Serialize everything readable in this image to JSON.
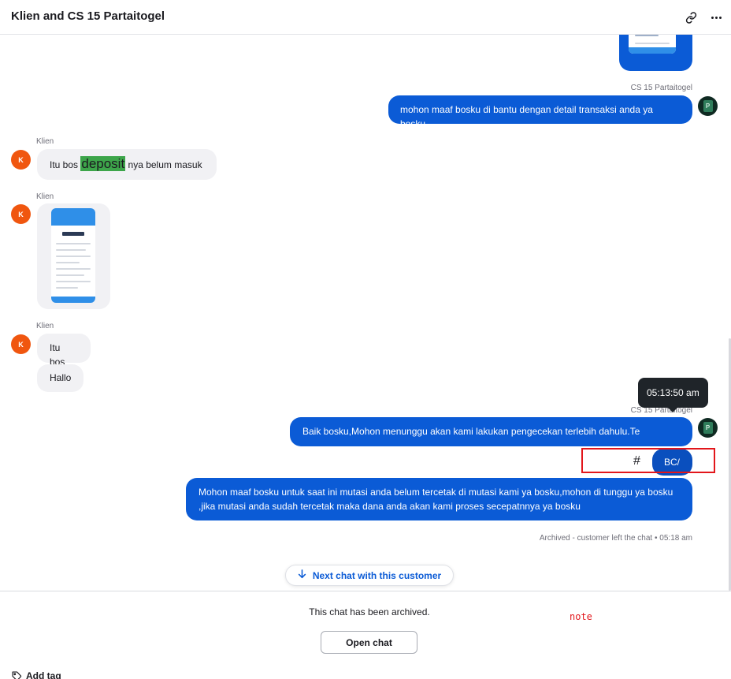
{
  "header": {
    "title": "Klien and CS 15 Partaitogel"
  },
  "agent": {
    "name": "CS 15 Partaitogel",
    "avatar_letter": "P"
  },
  "customer": {
    "name": "Klien",
    "avatar_letter": "K"
  },
  "messages": {
    "agent_1": "mohon maaf bosku di bantu dengan detail transaksi anda ya bosku",
    "customer_1_pre": "Itu bos ",
    "customer_1_highlight": "deposit",
    "customer_1_post": " nya belum masuk",
    "customer_3": "Itu bos",
    "customer_4": "Hallo",
    "agent_2": "Baik bosku,Mohon menunggu akan kami lakukan pengecekan terlebih dahulu.Te",
    "agent_3": "BC/",
    "agent_4_line1": "Mohon maaf bosku untuk saat ini mutasi anda belum tercetak di mutasi kami ya bosku,mohon di tunggu ya bosku",
    "agent_4_line2": ",jika mutasi anda sudah tercetak maka dana anda akan kami proses secepatnnya ya bosku"
  },
  "tooltip": {
    "time": "05:13:50 am"
  },
  "annotation": {
    "hash": "#",
    "note": "note",
    "color": "#e2161b"
  },
  "status": {
    "archived": "Archived - customer left the chat",
    "separator": "•",
    "time": "05:18 am"
  },
  "actions": {
    "next_chat": "Next chat with this customer",
    "archived_notice": "This chat has been archived.",
    "open_chat": "Open chat",
    "add_tag": "Add tag"
  },
  "colors": {
    "agent_bubble": "#0b5bd6",
    "customer_bubble": "#f1f1f4",
    "customer_avatar": "#f0560f",
    "highlight": "#3da54a"
  },
  "icons": {
    "link": "link-icon",
    "more": "more-horizontal-icon",
    "arrow": "arrow-down-icon",
    "tag": "tag-icon"
  }
}
